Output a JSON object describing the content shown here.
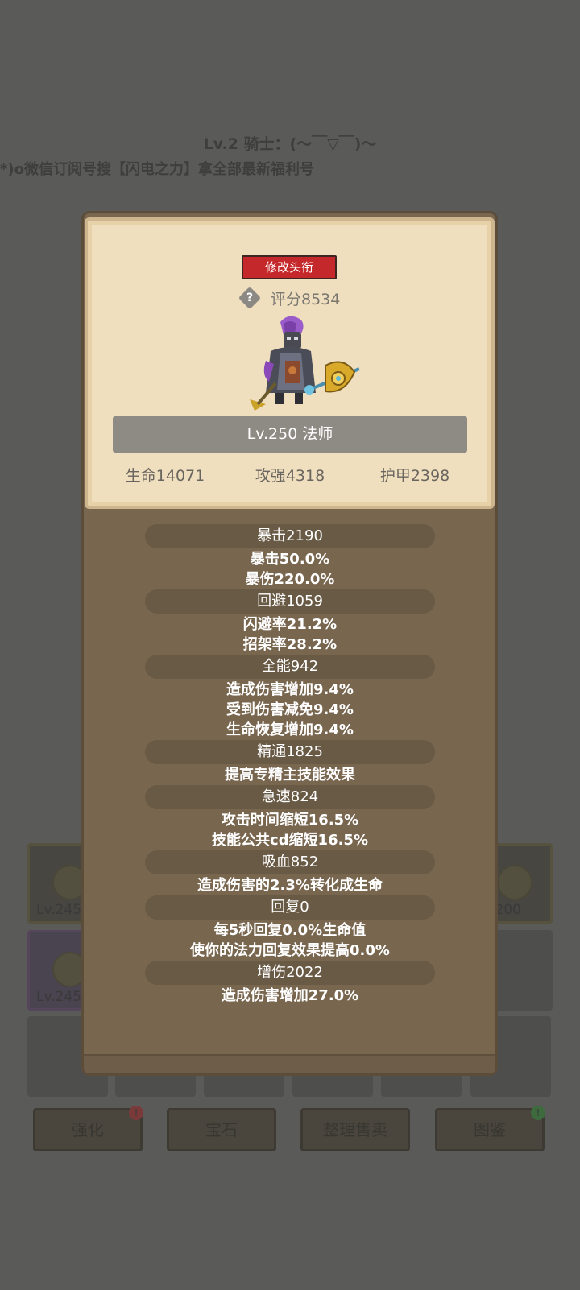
{
  "background": {
    "title": "Lv.2 骑士：(～￣▽￣)～",
    "subtitle": "*)o微信订阅号搜【闪电之力】拿全部最新福利号",
    "slots": [
      {
        "level": "Lv.245",
        "rarity": "gold"
      },
      {
        "level": "200",
        "rarity": "gold"
      },
      {
        "level": "Lv.245",
        "rarity": "purple"
      }
    ],
    "buttons": [
      {
        "label": "强化",
        "badge": "!"
      },
      {
        "label": "宝石",
        "badge": ""
      },
      {
        "label": "整理售卖",
        "badge": ""
      },
      {
        "label": "图鉴",
        "badge": "!"
      }
    ]
  },
  "profile": {
    "edit_title_label": "修改头衔",
    "rating": "评分8534",
    "name": "Lv.250 法师",
    "life": "生命14071",
    "attack": "攻强4318",
    "armor": "护甲2398"
  },
  "stats": [
    {
      "header": "暴击2190",
      "lines": [
        "暴击50.0%",
        "暴伤220.0%"
      ]
    },
    {
      "header": "回避1059",
      "lines": [
        "闪避率21.2%",
        "招架率28.2%"
      ]
    },
    {
      "header": "全能942",
      "lines": [
        "造成伤害增加9.4%",
        "受到伤害减免9.4%",
        "生命恢复增加9.4%"
      ]
    },
    {
      "header": "精通1825",
      "lines": [
        "提高专精主技能效果"
      ]
    },
    {
      "header": "急速824",
      "lines": [
        "攻击时间缩短16.5%",
        "技能公共cd缩短16.5%"
      ]
    },
    {
      "header": "吸血852",
      "lines": [
        "造成伤害的2.3%转化成生命"
      ]
    },
    {
      "header": "回复0",
      "lines": [
        "每5秒回复0.0%生命值",
        "使你的法力回复效果提高0.0%"
      ]
    },
    {
      "header": "增伤2022",
      "lines": [
        "造成伤害增加27.0%"
      ]
    }
  ]
}
